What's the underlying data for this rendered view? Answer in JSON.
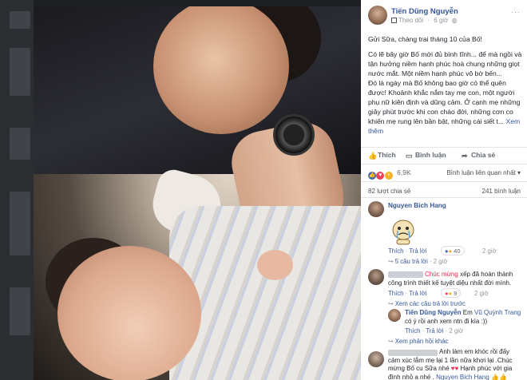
{
  "post": {
    "author": "Tiến Dũng Nguyễn",
    "follow_label": "Theo dõi",
    "time": "6 giờ",
    "paragraph1": "Gửi Sữa, chàng trai tháng 10 của Bố!",
    "paragraph2": "Có lẽ bây giờ Bố mới đủ bình tĩnh... để mà ngồi và tận hưởng niềm hạnh phúc hoà chung những giọt nước mắt. Một niềm hạnh phúc vô bờ bến...",
    "paragraph3": "Đó là ngày mà Bố không bao giờ có thể quên được! Khoảnh khắc nắm tay mẹ con, một người phụ nữ kiên định và dũng cảm. Ở cạnh mẹ những giây phút trước khi con chào đời, những cơn co khiến mẹ rung lên bần bật, những cái siết t...",
    "see_more": "Xem thêm"
  },
  "actions": {
    "like": "Thích",
    "comment": "Bình luận",
    "share": "Chia sẻ"
  },
  "stats": {
    "reactions": "6,9K",
    "sort_label": "Bình luận liên quan nhất",
    "shares": "82 lượt chia sẻ",
    "comments": "241 bình luận"
  },
  "comments": [
    {
      "name": "Nguyen Bich Hang",
      "like": "Thích",
      "reply": "Trả lời",
      "likes": "40",
      "time": "2 giờ",
      "replies_link": "5 câu trả lời",
      "replies_time": "2 giờ"
    },
    {
      "highlight": "Chúc mừng",
      "text_tail": "xếp đã hoàn thành công trình thiết kế tuyệt diệu nhất đời mình.",
      "like": "Thích",
      "reply": "Trả lời",
      "likes": "9",
      "time": "2 giờ",
      "prev_replies": "Xem các câu trả lời trước",
      "reply_name": "Tiến Dũng Nguyễn",
      "reply_prefix": "Em",
      "reply_tag": "Vũ Quỳnh Trang",
      "reply_text": "có ý rồi anh xem ntn đi kìa :))",
      "reply_like": "Thích",
      "reply_reply": "Trả lời",
      "reply_time": "2 giờ",
      "more_replies": "Xem phản hồi khác"
    },
    {
      "text1": "Anh làm em khóc rồi đấy",
      "text2": "cảm xúc lắm mẹ lại 1 lần nữa khơi lại .Chúc",
      "text3": "mừng Bố cu Sữa nhé",
      "text3b": "Hạnh phúc với gia",
      "text4": "đình nhỏ a nhé .",
      "tag": "Nguyen Bich Hang"
    }
  ],
  "colors": {
    "link": "#365899",
    "highlight": "#f02849",
    "like_blue": "#4267b2"
  },
  "icons": {
    "like": "thumbs-up-icon",
    "comment": "speech-bubble-icon",
    "share": "share-arrow-icon"
  }
}
